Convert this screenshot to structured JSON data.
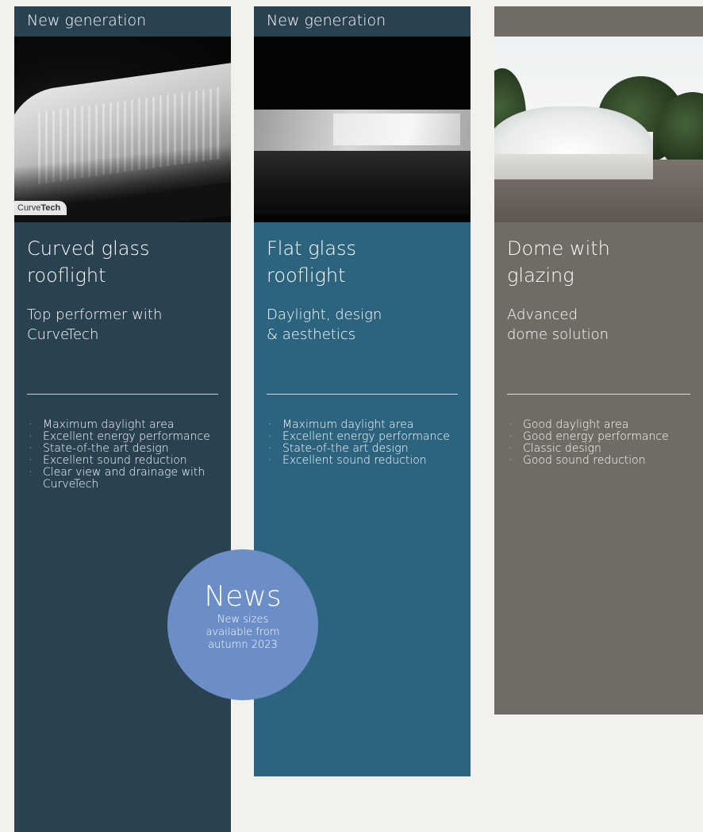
{
  "products": [
    {
      "tag": "New generation",
      "title": "Curved glass\nrooflight",
      "subtitle": "Top performer with\nCurveTech",
      "logo_text_a": "Curve",
      "logo_text_b": "Tech",
      "features": [
        "Maximum daylight area",
        "Excellent energy performance",
        "State-of-the art design",
        "Excellent sound reduction",
        "Clear view and drainage with CurveTech"
      ]
    },
    {
      "tag": "New generation",
      "title": "Flat glass\nrooflight",
      "subtitle": "Daylight, design\n& aesthetics",
      "features": [
        "Maximum daylight area",
        "Excellent energy performance",
        "State-of-the art design",
        "Excellent sound reduction"
      ]
    },
    {
      "tag": "",
      "title": "Dome with\nglazing",
      "subtitle": "Advanced\ndome solution",
      "features": [
        "Good daylight area",
        "Good energy performance",
        "Classic design",
        "Good sound reduction"
      ]
    }
  ],
  "news": {
    "title": "News",
    "text": "New sizes\navailable from\nautumn 2023"
  },
  "colors": {
    "background": "#f2f1ed",
    "curved_card": "#2a4150",
    "flat_card": "#2c6480",
    "dome_card": "#716b65",
    "news_badge": "#6b8ec9"
  }
}
